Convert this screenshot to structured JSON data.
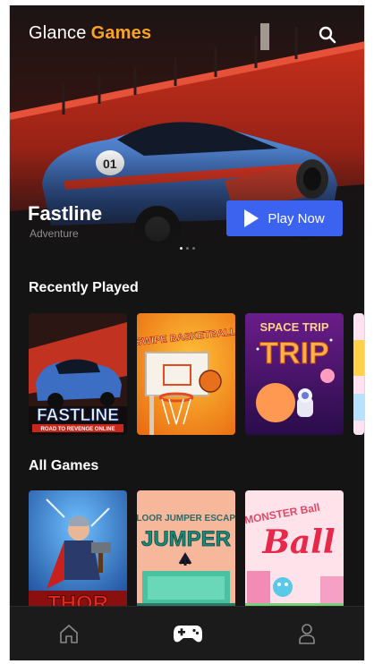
{
  "brand": {
    "word1": "Glance",
    "word2": "Games",
    "accent_color": "#f7a325"
  },
  "header": {
    "search_icon": "search-icon"
  },
  "hero": {
    "title": "Fastline",
    "genre": "Adventure",
    "play_label": "Play Now",
    "play_color": "#3b63f0",
    "carousel": {
      "total": 3,
      "active": 0
    }
  },
  "sections": {
    "recently_played": {
      "title": "Recently Played",
      "games": [
        {
          "art_title": "FASTLINE",
          "art_subtitle": "ROAD TO REVENGE ONLINE"
        },
        {
          "art_title": "SWIPE BASKETBALL"
        },
        {
          "art_title": "SPACE TRIP"
        }
      ]
    },
    "all_games": {
      "title": "All Games",
      "games": [
        {
          "art_title": "THOR"
        },
        {
          "art_title": "FLOOR JUMPER ESCAPE"
        },
        {
          "art_title": "MONSTER Ball"
        }
      ]
    }
  },
  "nav": {
    "items": [
      {
        "icon": "home-icon",
        "active": false
      },
      {
        "icon": "gamepad-icon",
        "active": true
      },
      {
        "icon": "profile-icon",
        "active": false
      }
    ]
  }
}
